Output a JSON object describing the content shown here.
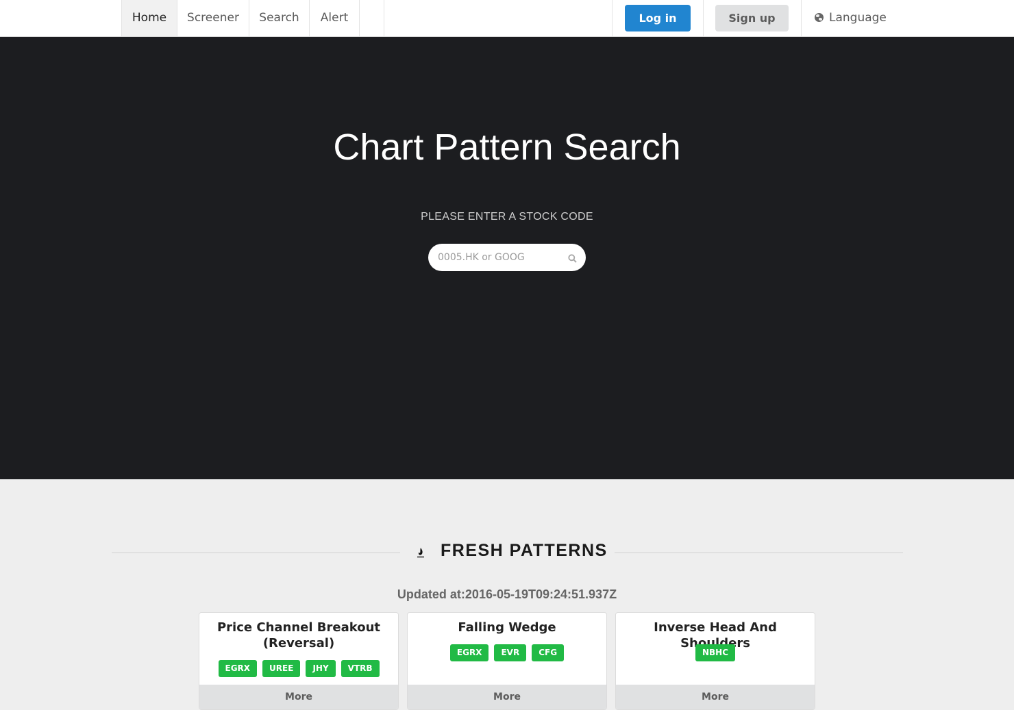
{
  "nav": {
    "items": [
      {
        "label": "Home",
        "active": true
      },
      {
        "label": "Screener"
      },
      {
        "label": "Search"
      },
      {
        "label": "Alert"
      }
    ],
    "login_label": "Log in",
    "signup_label": "Sign up",
    "language_label": "Language",
    "language_icon": "globe-icon"
  },
  "hero": {
    "title": "Chart Pattern Search",
    "subtitle": "PLEASE ENTER A STOCK CODE",
    "search_placeholder": "0005.HK or GOOG",
    "search_icon": "search-icon"
  },
  "section": {
    "icon": "fire-icon",
    "title": "FRESH PATTERNS",
    "updated": "Updated at:2016-05-19T09:24:51.937Z"
  },
  "cards": [
    {
      "title": "Price Channel Breakout (Reversal)",
      "tickers": [
        "EGRX",
        "UREE",
        "JHY",
        "VTRB"
      ],
      "more_label": "More"
    },
    {
      "title": "Falling Wedge",
      "tickers": [
        "EGRX",
        "EVR",
        "CFG"
      ],
      "more_label": "More"
    },
    {
      "title": "Inverse Head And Shoulders",
      "tickers": [
        "NBHC"
      ],
      "more_label": "More"
    }
  ],
  "colors": {
    "primary": "#2185d0",
    "tag_green": "#21ba45",
    "hero_bg": "#1c1d20",
    "page_bg": "#eeeeee"
  }
}
